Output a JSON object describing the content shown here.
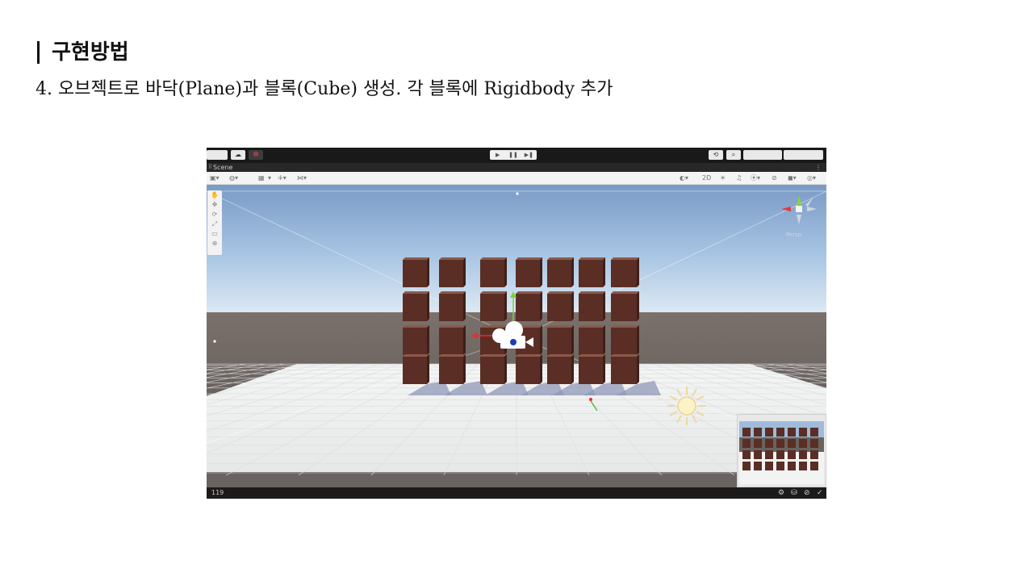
{
  "slide": {
    "title": "구현방법",
    "body": "4. 오브젝트로 바닥(Plane)과 블록(Cube) 생성. 각 블록에 Rigidbody 추가"
  },
  "editor": {
    "toolbar": {
      "account_box": "",
      "cloud_icon": "☁",
      "collab_icon": "✲",
      "play_icons": [
        "▶",
        "❚❚",
        "▶❚"
      ],
      "history_icon": "⟲",
      "search_icon": "⌕",
      "layers_dropdown": "",
      "layout_dropdown": ""
    },
    "scene_tab": {
      "grip": "⠿",
      "label": "Scene",
      "menu": "⋮"
    },
    "scene_toolbar": {
      "left_icons": [
        "▣▾",
        "◍▾",
        "▦",
        "▾",
        "⁜▾",
        "⋈▾"
      ],
      "right_icons": [
        "◐▾",
        "2D",
        "☀",
        "♫",
        "⦿▾",
        "⊘",
        "◼▾",
        "◎▾"
      ]
    },
    "tools": [
      "✋",
      "✥",
      "⟳",
      "⤢",
      "▭",
      "⊕"
    ],
    "gizmo": {
      "label": "Persp"
    },
    "status": {
      "count": "119",
      "icons": [
        "⚙",
        "⛁",
        "⊘",
        "✓"
      ]
    },
    "colors": {
      "sky_top": "#7f9ec9",
      "horizon": "#cfe0f0",
      "ground_far": "#6b625f",
      "plane": "#f2f3f3",
      "cube_front": "#5a2e25",
      "cube_top": "#8b5a4a",
      "shadow": "#8f98b8"
    }
  }
}
